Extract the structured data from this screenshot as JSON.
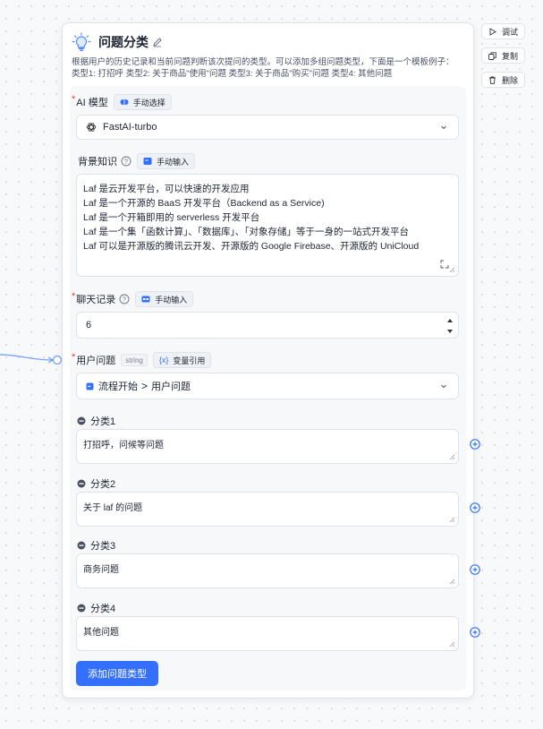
{
  "node": {
    "title": "问题分类",
    "description": "根据用户的历史记录和当前问题判断该次提问的类型。可以添加多组问题类型，下面是一个模板例子： 类型1: 打招呼 类型2: 关于商品\"使用\"问题 类型3: 关于商品\"购买\"问题 类型4: 其他问题"
  },
  "side_actions": [
    {
      "label": "调试",
      "icon": "play-icon"
    },
    {
      "label": "复制",
      "icon": "copy-icon"
    },
    {
      "label": "删除",
      "icon": "trash-icon"
    }
  ],
  "model": {
    "label": "AI 模型",
    "mode_label": "手动选择",
    "value": "FastAI-turbo"
  },
  "knowledge": {
    "label": "背景知识",
    "mode_label": "手动输入",
    "lines": [
      "Laf 是云开发平台，可以快速的开发应用",
      "Laf 是一个开源的 BaaS 开发平台（Backend as a Service)",
      "Laf 是一个开箱即用的 serverless 开发平台",
      "Laf 是一个集「函数计算」、「数据库」、「对象存储」等于一身的一站式开发平台",
      "Laf 可以是开源版的腾讯云开发、开源版的 Google Firebase、开源版的 UniCloud"
    ]
  },
  "history": {
    "label": "聊天记录",
    "mode_label": "手动输入",
    "value": "6"
  },
  "question": {
    "label": "用户问题",
    "type": "string",
    "mode_label": "变量引用",
    "source": "流程开始",
    "separator": ">",
    "variable": "用户问题"
  },
  "categories": [
    {
      "label": "分类1",
      "value": "打招呼，问候等问题"
    },
    {
      "label": "分类2",
      "value": "关于 laf 的问题"
    },
    {
      "label": "分类3",
      "value": "商务问题"
    },
    {
      "label": "分类4",
      "value": "其他问题"
    }
  ],
  "add_button": "添加问题类型",
  "colors": {
    "primary": "#3370ff",
    "required": "#e43d3d",
    "border": "#dfe2e8"
  }
}
